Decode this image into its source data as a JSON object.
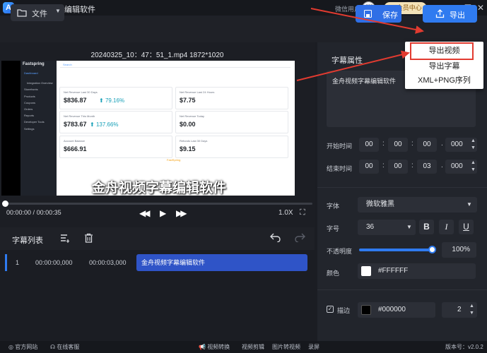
{
  "app": {
    "logo": "A",
    "title": "金舟视频字幕编辑软件",
    "wechat_user": "微信用户",
    "vip_label": "会员中心"
  },
  "toolbar": {
    "file_label": "文件",
    "save_label": "保存",
    "export_label": "导出"
  },
  "export_menu": {
    "items": [
      "导出视频",
      "导出字幕",
      "XML+PNG序列"
    ],
    "highlighted": "导出视频"
  },
  "video": {
    "file_info": "20240325_10：47：51_1.mp4   1872*1020",
    "subtitle_overlay": "金舟视频字幕编辑软件",
    "current_time": "00:00:00",
    "total_time": "00:00:35",
    "time_sep": " / ",
    "zoom": "1.0X",
    "progress": 0.0
  },
  "video_content": {
    "brand": "Fastspring",
    "nav": [
      "Dashboard",
      "Integration Overview",
      "Storefronts",
      "Products",
      "Coupons",
      "Orders",
      "Reports",
      "Developer Tools",
      "Settings"
    ],
    "search": "Search",
    "cards": [
      {
        "label": "Net Revenue Last 30 Days",
        "value": "$836.87",
        "delta": "79.16%"
      },
      {
        "label": "Net Revenue Last 24 Hours",
        "value": "$7.75",
        "delta": ""
      },
      {
        "label": "Net Revenue This Month",
        "value": "$783.67",
        "delta": "137.66%"
      },
      {
        "label": "Net Revenue Today",
        "value": "$0.00",
        "delta": ""
      },
      {
        "label": "Account Balance",
        "value": "$666.91",
        "delta": ""
      },
      {
        "label": "Refunds Last 30 Days",
        "value": "$9.15",
        "delta": ""
      }
    ],
    "footer_brand": "FastSpring"
  },
  "subtitle_list": {
    "title": "字幕列表",
    "rows": [
      {
        "index": "1",
        "start": "00:00:00,000",
        "end": "00:00:03,000",
        "text": "金舟视频字幕编辑软件"
      }
    ]
  },
  "properties": {
    "title": "字幕属性",
    "text": "金舟视频字幕编辑软件",
    "start_label": "开始时间",
    "start": {
      "h": "00",
      "m": "00",
      "s": "00",
      "ms": "000"
    },
    "end_label": "结束时间",
    "end": {
      "h": "00",
      "m": "00",
      "s": "03",
      "ms": "000"
    },
    "font_label": "字体",
    "font_value": "微软雅黑",
    "size_label": "字号",
    "size_value": "36",
    "bold": "B",
    "italic": "I",
    "underline": "U",
    "opacity_label": "不透明度",
    "opacity_value": "100%",
    "opacity": 1.0,
    "color_label": "颜色",
    "color_value": "#FFFFFF",
    "stroke_label": "描边",
    "stroke_checked": true,
    "stroke_color": "#000000",
    "stroke_width": "2"
  },
  "statusbar": {
    "website": "官方网站",
    "support": "在线客服",
    "tools": [
      "视频转换",
      "视频剪辑",
      "图片转视频",
      "录屏"
    ],
    "version": "版本号：v2.0.2"
  },
  "colors": {
    "accent": "#2f7bf0",
    "annotation": "#e23b30"
  }
}
